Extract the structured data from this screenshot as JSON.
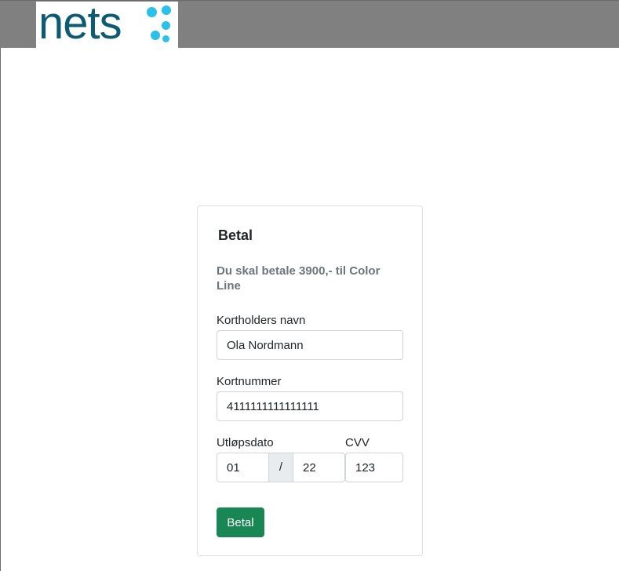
{
  "header": {
    "logo_text": "nets",
    "logo_colors": {
      "text": "#0d5a73",
      "dots": "#2ac1ea"
    },
    "bar_color": "#808080"
  },
  "payment": {
    "title": "Betal",
    "subtitle": "Du skal betale 3900,- til Color Line",
    "cardholder": {
      "label": "Kortholders navn",
      "value": "Ola Nordmann"
    },
    "card_number": {
      "label": "Kortnummer",
      "value": "4111111111111111"
    },
    "expiry": {
      "label": "Utløpsdato",
      "month": "01",
      "separator": "/",
      "year": "22"
    },
    "cvv": {
      "label": "CVV",
      "value": "123"
    },
    "submit_label": "Betal",
    "submit_color": "#198754"
  }
}
